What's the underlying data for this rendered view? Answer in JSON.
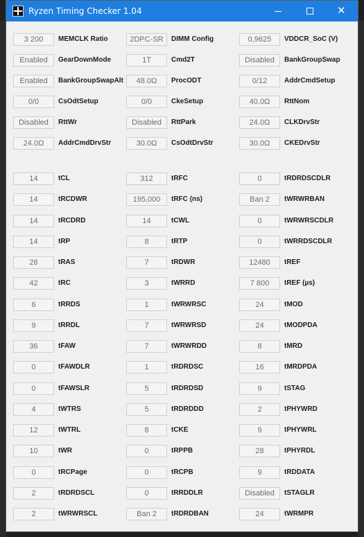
{
  "window": {
    "title": "Ryzen Timing Checker 1.04",
    "accent_color": "#1f7fe0",
    "min_icon": "minimize-icon",
    "max_icon": "maximize-icon",
    "close_icon": "close-icon",
    "close_glyph": "✕"
  },
  "config": {
    "col1": [
      {
        "value": "3 200",
        "label": "MEMCLK Ratio"
      },
      {
        "value": "Enabled",
        "label": "GearDownMode"
      },
      {
        "value": "Enabled",
        "label": "BankGroupSwapAlt"
      },
      {
        "value": "0/0",
        "label": "CsOdtSetup"
      },
      {
        "value": "Disabled",
        "label": "RttWr"
      },
      {
        "value": "24.0Ω",
        "label": "AddrCmdDrvStr"
      }
    ],
    "col2": [
      {
        "value": "2DPC-SR",
        "label": "DIMM Config"
      },
      {
        "value": "1T",
        "label": "Cmd2T"
      },
      {
        "value": "48.0Ω",
        "label": "ProcODT"
      },
      {
        "value": "0/0",
        "label": "CkeSetup"
      },
      {
        "value": "Disabled",
        "label": "RttPark"
      },
      {
        "value": "30.0Ω",
        "label": "CsOdtDrvStr"
      }
    ],
    "col3": [
      {
        "value": "0,9625",
        "label": "VDDCR_SoC (V)"
      },
      {
        "value": "Disabled",
        "label": "BankGroupSwap"
      },
      {
        "value": "0/12",
        "label": "AddrCmdSetup"
      },
      {
        "value": "40.0Ω",
        "label": "RttNom"
      },
      {
        "value": "24.0Ω",
        "label": "CLKDrvStr"
      },
      {
        "value": "30.0Ω",
        "label": "CKEDrvStr"
      }
    ]
  },
  "timings": {
    "col1": [
      {
        "value": "14",
        "label": "tCL"
      },
      {
        "value": "14",
        "label": "tRCDWR"
      },
      {
        "value": "14",
        "label": "tRCDRD"
      },
      {
        "value": "14",
        "label": "tRP"
      },
      {
        "value": "28",
        "label": "tRAS"
      },
      {
        "value": "42",
        "label": "tRC"
      },
      {
        "value": "6",
        "label": "tRRDS"
      },
      {
        "value": "9",
        "label": "tRRDL"
      },
      {
        "value": "36",
        "label": "tFAW"
      },
      {
        "value": "0",
        "label": "tFAWDLR"
      },
      {
        "value": "0",
        "label": "tFAWSLR"
      },
      {
        "value": "4",
        "label": "tWTRS"
      },
      {
        "value": "12",
        "label": "tWTRL"
      },
      {
        "value": "10",
        "label": "tWR"
      },
      {
        "value": "0",
        "label": "tRCPage"
      },
      {
        "value": "2",
        "label": "tRDRDSCL"
      },
      {
        "value": "2",
        "label": "tWRWRSCL"
      }
    ],
    "col2": [
      {
        "value": "312",
        "label": "tRFC"
      },
      {
        "value": "195,000",
        "label": "tRFC (ns)"
      },
      {
        "value": "14",
        "label": "tCWL"
      },
      {
        "value": "8",
        "label": "tRTP"
      },
      {
        "value": "7",
        "label": "tRDWR"
      },
      {
        "value": "3",
        "label": "tWRRD"
      },
      {
        "value": "1",
        "label": "tWRWRSC"
      },
      {
        "value": "7",
        "label": "tWRWRSD"
      },
      {
        "value": "7",
        "label": "tWRWRDD"
      },
      {
        "value": "1",
        "label": "tRDRDSC"
      },
      {
        "value": "5",
        "label": "tRDRDSD"
      },
      {
        "value": "5",
        "label": "tRDRDDD"
      },
      {
        "value": "8",
        "label": "tCKE"
      },
      {
        "value": "0",
        "label": "tRPPB"
      },
      {
        "value": "0",
        "label": "tRCPB"
      },
      {
        "value": "0",
        "label": "tRRDDLR"
      },
      {
        "value": "Ban 2",
        "label": "tRDRDBAN"
      }
    ],
    "col3": [
      {
        "value": "0",
        "label": "tRDRDSCDLR"
      },
      {
        "value": "Ban 2",
        "label": "tWRWRBAN"
      },
      {
        "value": "0",
        "label": "tWRWRSCDLR"
      },
      {
        "value": "0",
        "label": "tWRRDSCDLR"
      },
      {
        "value": "12480",
        "label": "tREF"
      },
      {
        "value": "7 800",
        "label": "tREF (µs)"
      },
      {
        "value": "24",
        "label": "tMOD"
      },
      {
        "value": "24",
        "label": "tMODPDA"
      },
      {
        "value": "8",
        "label": "tMRD"
      },
      {
        "value": "16",
        "label": "tMRDPDA"
      },
      {
        "value": "9",
        "label": "tSTAG"
      },
      {
        "value": "2",
        "label": "tPHYWRD"
      },
      {
        "value": "9",
        "label": "tPHYWRL"
      },
      {
        "value": "28",
        "label": "tPHYRDL"
      },
      {
        "value": "9",
        "label": "tRDDATA"
      },
      {
        "value": "Disabled",
        "label": "tSTAGLR"
      },
      {
        "value": "24",
        "label": "tWRMPR"
      }
    ]
  }
}
